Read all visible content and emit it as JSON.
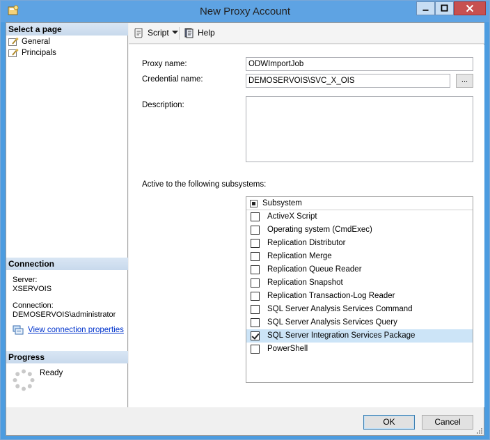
{
  "window": {
    "title": "New Proxy Account"
  },
  "left": {
    "select_page_header": "Select a page",
    "pages": [
      {
        "label": "General"
      },
      {
        "label": "Principals"
      }
    ],
    "connection_header": "Connection",
    "server_label": "Server:",
    "server_value": "XSERVOIS",
    "connection_label": "Connection:",
    "connection_value": "DEMOSERVOIS\\administrator",
    "view_props_link": "View connection properties",
    "progress_header": "Progress",
    "progress_status": "Ready"
  },
  "toolbar": {
    "script_label": "Script",
    "help_label": "Help"
  },
  "form": {
    "proxy_name_label": "Proxy name:",
    "proxy_name_value": "ODWImportJob",
    "credential_label": "Credential name:",
    "credential_value": "DEMOSERVOIS\\SVC_X_OIS",
    "browse_label": "...",
    "description_label": "Description:",
    "description_value": "",
    "subsystems_label": "Active to the following subsystems:",
    "subsystem_header": "Subsystem",
    "subsystems": [
      {
        "label": "ActiveX Script",
        "checked": false
      },
      {
        "label": "Operating system (CmdExec)",
        "checked": false
      },
      {
        "label": "Replication Distributor",
        "checked": false
      },
      {
        "label": "Replication Merge",
        "checked": false
      },
      {
        "label": "Replication Queue Reader",
        "checked": false
      },
      {
        "label": "Replication Snapshot",
        "checked": false
      },
      {
        "label": "Replication Transaction-Log Reader",
        "checked": false
      },
      {
        "label": "SQL Server Analysis Services Command",
        "checked": false
      },
      {
        "label": "SQL Server Analysis Services Query",
        "checked": false
      },
      {
        "label": "SQL Server Integration Services Package",
        "checked": true
      },
      {
        "label": "PowerShell",
        "checked": false
      }
    ]
  },
  "buttons": {
    "ok": "OK",
    "cancel": "Cancel"
  },
  "colors": {
    "titlebar": "#5ea3e3",
    "close": "#c75050",
    "selection": "#cce4f7",
    "link": "#0033cc"
  }
}
